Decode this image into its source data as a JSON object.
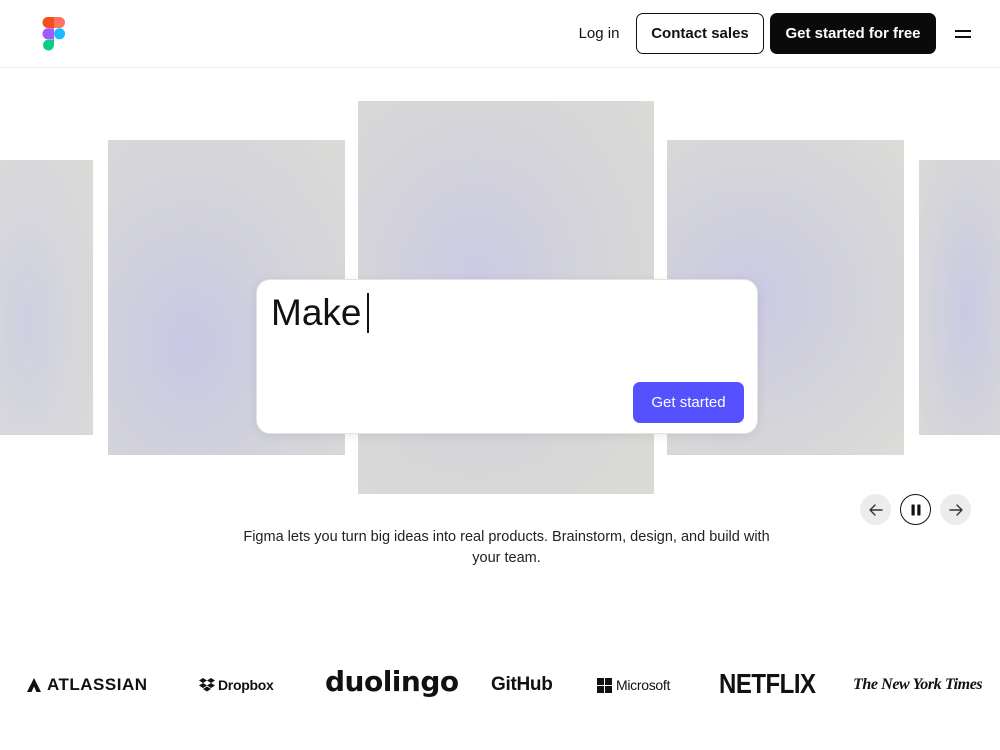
{
  "header": {
    "login_label": "Log in",
    "contact_label": "Contact sales",
    "get_started_free_label": "Get started for free"
  },
  "hero": {
    "prompt_text": "Make",
    "get_started_label": "Get started",
    "tagline": "Figma lets you turn big ideas into real products. Brainstorm, design, and build with your team."
  },
  "logos": {
    "atlassian": "ATLASSIAN",
    "dropbox": "Dropbox",
    "duolingo": "duolingo",
    "github": "GitHub",
    "microsoft": "Microsoft",
    "netflix": "NETFLIX",
    "nyt": "The New York Times"
  },
  "colors": {
    "accent": "#5551ff",
    "dark_button": "#0a0a0a",
    "figma_red": "#f24e1e",
    "figma_orange": "#ff7262",
    "figma_purple": "#a259ff",
    "figma_blue": "#1abcfe",
    "figma_green": "#0acf83"
  },
  "icons": {
    "logo": "figma-logo-icon",
    "menu": "hamburger-menu-icon",
    "prev": "arrow-left-icon",
    "pause": "pause-icon",
    "next": "arrow-right-icon"
  }
}
